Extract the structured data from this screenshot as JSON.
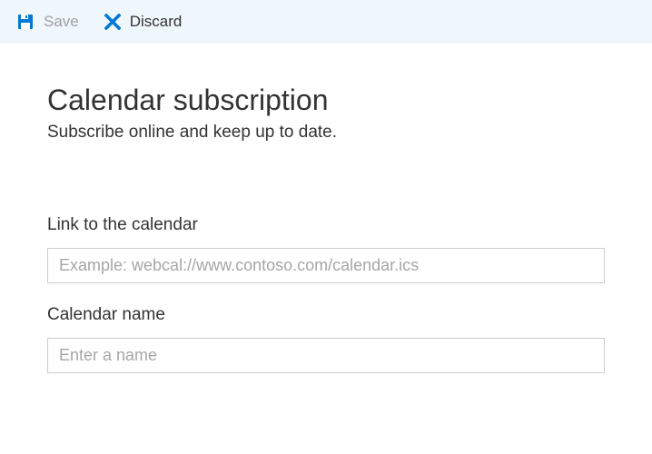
{
  "toolbar": {
    "save_label": "Save",
    "discard_label": "Discard"
  },
  "page": {
    "title": "Calendar subscription",
    "subtitle": "Subscribe online and keep up to date."
  },
  "form": {
    "link": {
      "label": "Link to the calendar",
      "placeholder": "Example: webcal://www.contoso.com/calendar.ics",
      "value": ""
    },
    "name": {
      "label": "Calendar name",
      "placeholder": "Enter a name",
      "value": ""
    }
  },
  "colors": {
    "accent": "#0078d4",
    "toolbar_bg": "#eff6fc"
  }
}
